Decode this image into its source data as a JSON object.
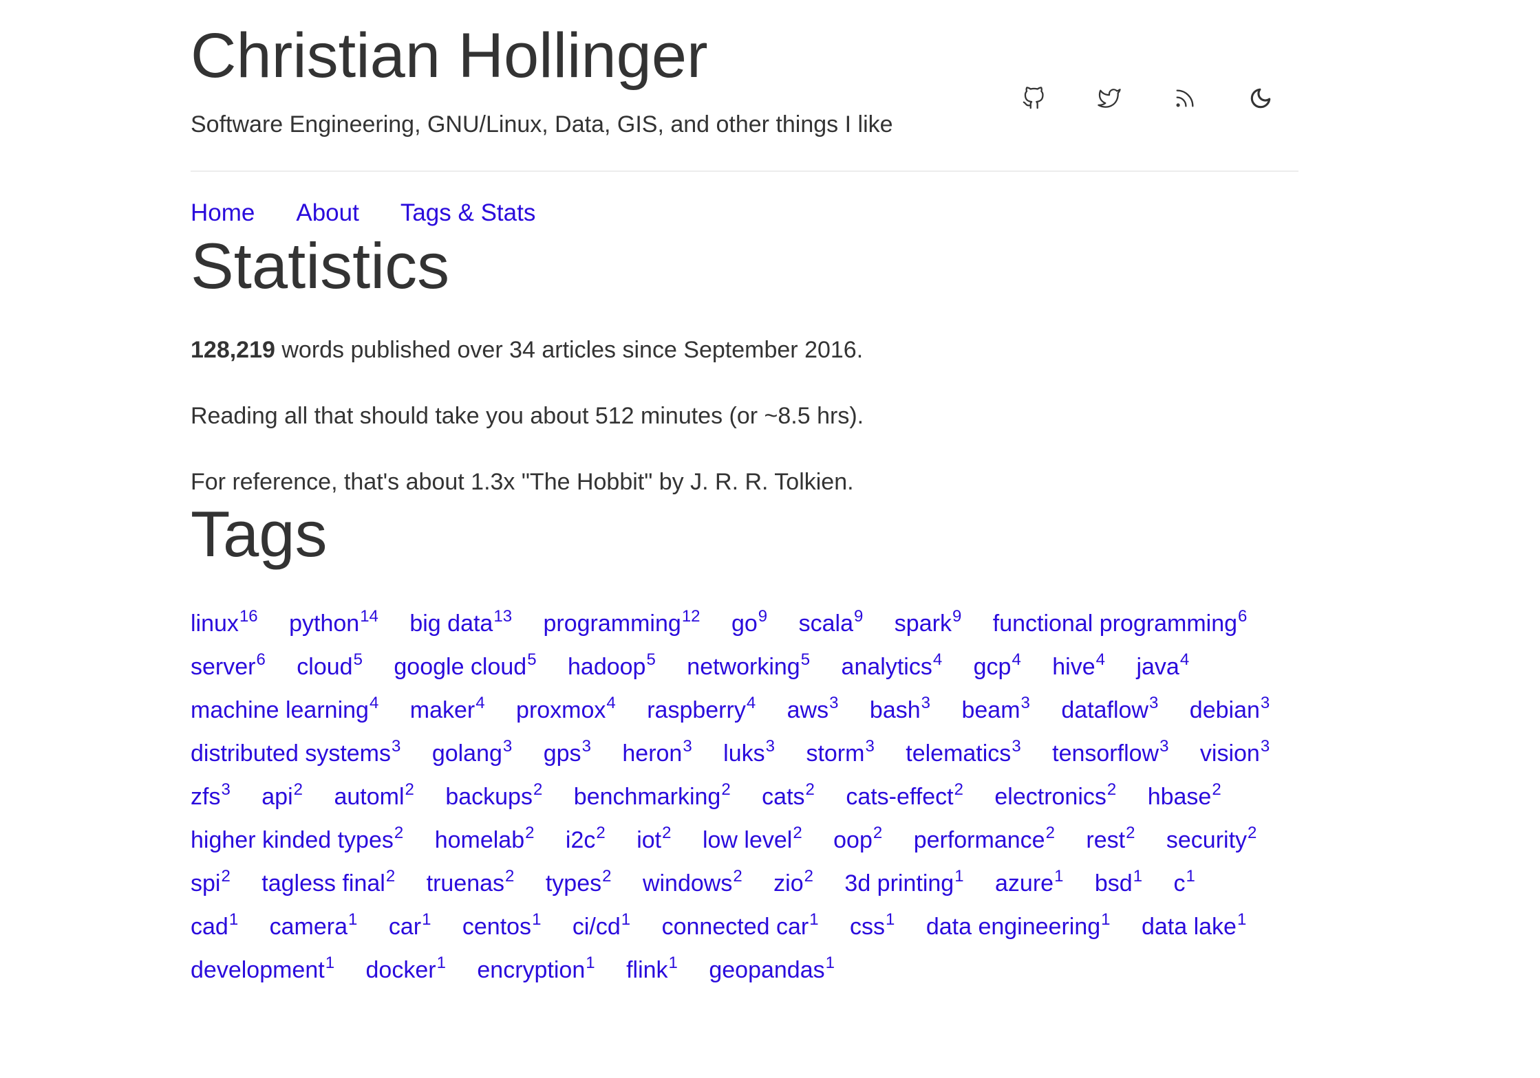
{
  "site": {
    "title": "Christian Hollinger",
    "subtitle": "Software Engineering, GNU/Linux, Data, GIS, and other things I like"
  },
  "social_icons": [
    "github-icon",
    "twitter-icon",
    "rss-icon",
    "moon-icon"
  ],
  "nav": [
    "Home",
    "About",
    "Tags & Stats"
  ],
  "statistics": {
    "heading": "Statistics",
    "word_count": "128,219",
    "line1_rest": " words published over 34 articles since September 2016.",
    "line2": "Reading all that should take you about 512 minutes (or ~8.5 hrs).",
    "line3": "For reference, that's about 1.3x \"The Hobbit\" by J. R. R. Tolkien."
  },
  "tags": {
    "heading": "Tags",
    "items": [
      {
        "name": "linux",
        "count": "16"
      },
      {
        "name": "python",
        "count": "14"
      },
      {
        "name": "big data",
        "count": "13"
      },
      {
        "name": "programming",
        "count": "12"
      },
      {
        "name": "go",
        "count": "9"
      },
      {
        "name": "scala",
        "count": "9"
      },
      {
        "name": "spark",
        "count": "9"
      },
      {
        "name": "functional programming",
        "count": "6"
      },
      {
        "name": "server",
        "count": "6"
      },
      {
        "name": "cloud",
        "count": "5"
      },
      {
        "name": "google cloud",
        "count": "5"
      },
      {
        "name": "hadoop",
        "count": "5"
      },
      {
        "name": "networking",
        "count": "5"
      },
      {
        "name": "analytics",
        "count": "4"
      },
      {
        "name": "gcp",
        "count": "4"
      },
      {
        "name": "hive",
        "count": "4"
      },
      {
        "name": "java",
        "count": "4"
      },
      {
        "name": "machine learning",
        "count": "4"
      },
      {
        "name": "maker",
        "count": "4"
      },
      {
        "name": "proxmox",
        "count": "4"
      },
      {
        "name": "raspberry",
        "count": "4"
      },
      {
        "name": "aws",
        "count": "3"
      },
      {
        "name": "bash",
        "count": "3"
      },
      {
        "name": "beam",
        "count": "3"
      },
      {
        "name": "dataflow",
        "count": "3"
      },
      {
        "name": "debian",
        "count": "3"
      },
      {
        "name": "distributed systems",
        "count": "3"
      },
      {
        "name": "golang",
        "count": "3"
      },
      {
        "name": "gps",
        "count": "3"
      },
      {
        "name": "heron",
        "count": "3"
      },
      {
        "name": "luks",
        "count": "3"
      },
      {
        "name": "storm",
        "count": "3"
      },
      {
        "name": "telematics",
        "count": "3"
      },
      {
        "name": "tensorflow",
        "count": "3"
      },
      {
        "name": "vision",
        "count": "3"
      },
      {
        "name": "zfs",
        "count": "3"
      },
      {
        "name": "api",
        "count": "2"
      },
      {
        "name": "automl",
        "count": "2"
      },
      {
        "name": "backups",
        "count": "2"
      },
      {
        "name": "benchmarking",
        "count": "2"
      },
      {
        "name": "cats",
        "count": "2"
      },
      {
        "name": "cats-effect",
        "count": "2"
      },
      {
        "name": "electronics",
        "count": "2"
      },
      {
        "name": "hbase",
        "count": "2"
      },
      {
        "name": "higher kinded types",
        "count": "2"
      },
      {
        "name": "homelab",
        "count": "2"
      },
      {
        "name": "i2c",
        "count": "2"
      },
      {
        "name": "iot",
        "count": "2"
      },
      {
        "name": "low level",
        "count": "2"
      },
      {
        "name": "oop",
        "count": "2"
      },
      {
        "name": "performance",
        "count": "2"
      },
      {
        "name": "rest",
        "count": "2"
      },
      {
        "name": "security",
        "count": "2"
      },
      {
        "name": "spi",
        "count": "2"
      },
      {
        "name": "tagless final",
        "count": "2"
      },
      {
        "name": "truenas",
        "count": "2"
      },
      {
        "name": "types",
        "count": "2"
      },
      {
        "name": "windows",
        "count": "2"
      },
      {
        "name": "zio",
        "count": "2"
      },
      {
        "name": "3d printing",
        "count": "1"
      },
      {
        "name": "azure",
        "count": "1"
      },
      {
        "name": "bsd",
        "count": "1"
      },
      {
        "name": "c",
        "count": "1"
      },
      {
        "name": "cad",
        "count": "1"
      },
      {
        "name": "camera",
        "count": "1"
      },
      {
        "name": "car",
        "count": "1"
      },
      {
        "name": "centos",
        "count": "1"
      },
      {
        "name": "ci/cd",
        "count": "1"
      },
      {
        "name": "connected car",
        "count": "1"
      },
      {
        "name": "css",
        "count": "1"
      },
      {
        "name": "data engineering",
        "count": "1"
      },
      {
        "name": "data lake",
        "count": "1"
      },
      {
        "name": "development",
        "count": "1"
      },
      {
        "name": "docker",
        "count": "1"
      },
      {
        "name": "encryption",
        "count": "1"
      },
      {
        "name": "flink",
        "count": "1"
      },
      {
        "name": "geopandas",
        "count": "1"
      }
    ]
  }
}
